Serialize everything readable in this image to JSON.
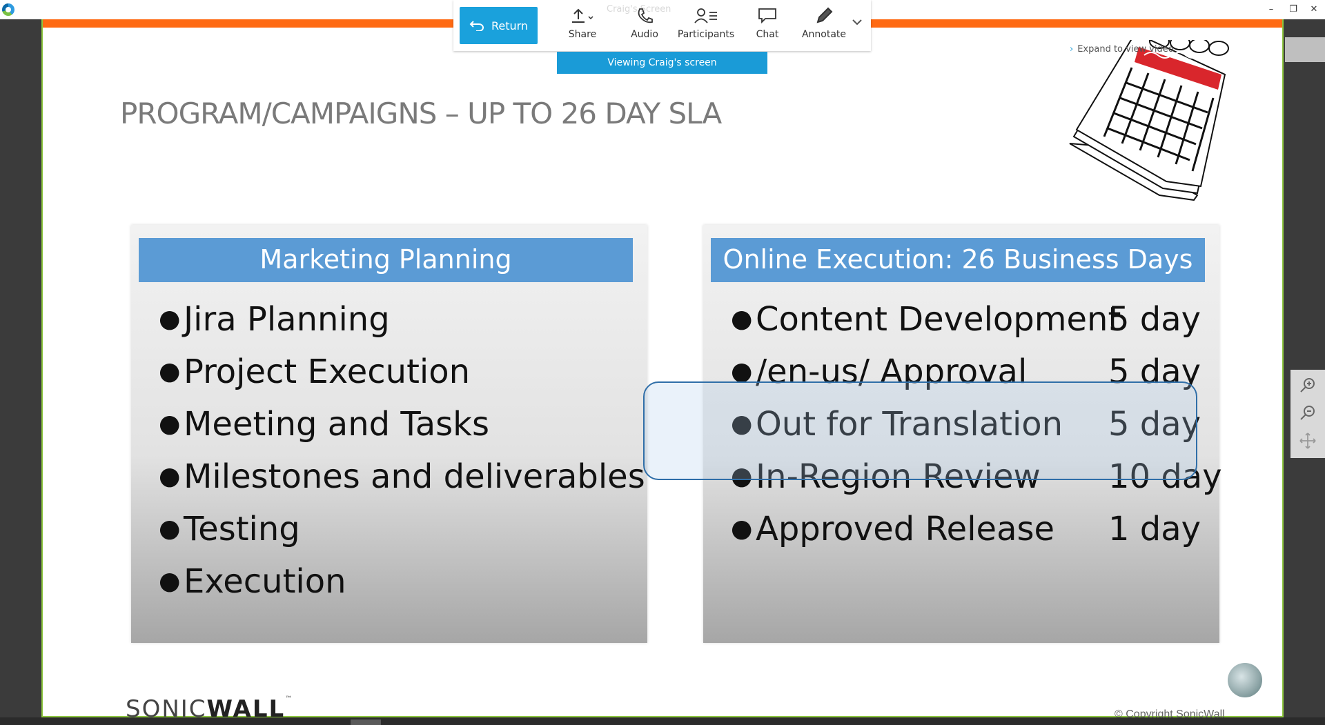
{
  "window": {
    "title": "Craig's Screen",
    "controls": [
      "–",
      "❐",
      "✕"
    ]
  },
  "toolbar": {
    "return_label": "Return",
    "items": [
      {
        "label": "Share",
        "icon": "share-icon"
      },
      {
        "label": "Audio",
        "icon": "phone-icon"
      },
      {
        "label": "Participants",
        "icon": "participants-icon"
      },
      {
        "label": "Chat",
        "icon": "chat-icon"
      },
      {
        "label": "Annotate",
        "icon": "pencil-icon"
      }
    ],
    "more_icon": "chevron-down-icon"
  },
  "viewing_banner": "Viewing Craig's screen",
  "expand_link": "Expand to view video",
  "slide": {
    "title": "PROGRAM/CAMPAIGNS – UP TO 26 DAY SLA",
    "left_panel": {
      "header": "Marketing Planning",
      "items": [
        "Jira Planning",
        "Project Execution",
        "Meeting and Tasks",
        "Milestones and deliverables",
        "Testing",
        "Execution"
      ]
    },
    "right_panel": {
      "header": "Online Execution: 26 Business Days",
      "items": [
        {
          "label": "Content Development",
          "days": "5 day"
        },
        {
          "label": "/en-us/ Approval",
          "days": "5 day"
        },
        {
          "label": "Out for Translation",
          "days": "5 day"
        },
        {
          "label": "In-Region Review",
          "days": "10 day"
        },
        {
          "label": "Approved Release",
          "days": "1 day"
        }
      ]
    },
    "brand": {
      "part1": "SONIC",
      "part2": "WALL",
      "tm": "™"
    },
    "copyright": "© Copyright SonicWall"
  },
  "colors": {
    "accent_orange": "#ff6a13",
    "header_blue": "#5b9bd5",
    "return_blue": "#1aa1dc",
    "border_green": "#8dc63f"
  }
}
